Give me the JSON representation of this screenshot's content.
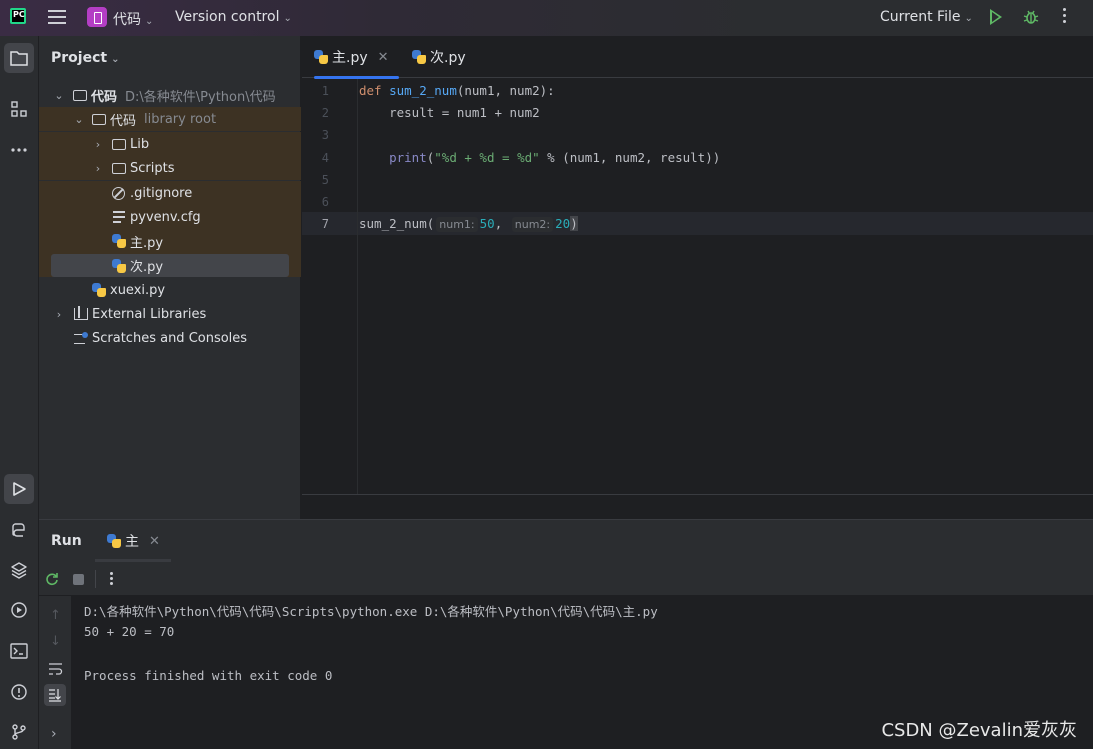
{
  "titlebar": {
    "logo_text": "PC",
    "project_name": "代码",
    "vcs_label": "Version control",
    "run_config": "Current File"
  },
  "project_panel": {
    "title": "Project",
    "tree": [
      {
        "name": "代码",
        "extra": "D:\\各种软件\\Python\\代码"
      },
      {
        "name": "代码",
        "extra": "library root"
      },
      {
        "name": "Lib"
      },
      {
        "name": "Scripts"
      },
      {
        "name": ".gitignore"
      },
      {
        "name": "pyvenv.cfg"
      },
      {
        "name": "主.py"
      },
      {
        "name": "次.py"
      },
      {
        "name": "xuexi.py"
      },
      {
        "name": "External Libraries"
      },
      {
        "name": "Scratches and Consoles"
      }
    ]
  },
  "editor": {
    "tabs": [
      {
        "label": "主.py",
        "active": true
      },
      {
        "label": "次.py",
        "active": false
      }
    ],
    "line_numbers": [
      "1",
      "2",
      "3",
      "4",
      "5",
      "6",
      "7"
    ],
    "code": {
      "l1_kw": "def",
      "l1_fn": "sum_2_num",
      "l1_rest": "(num1, num2):",
      "l2": "    result = num1 + num2",
      "l4_indent": "    ",
      "l4_bi": "print",
      "l4_open": "(",
      "l4_str": "\"%d + %d = %d\"",
      "l4_rest": " % (num1, num2, result))",
      "l7_fn": "sum_2_num(",
      "l7_hint1": "num1:",
      "l7_val1": "50",
      "l7_sep": ", ",
      "l7_hint2": "num2:",
      "l7_val2": "20",
      "l7_close": ")"
    }
  },
  "run_panel": {
    "title": "Run",
    "tab_label": "主",
    "console": [
      "D:\\各种软件\\Python\\代码\\代码\\Scripts\\python.exe D:\\各种软件\\Python\\代码\\代码\\主.py",
      "50 + 20 = 70",
      "",
      "Process finished with exit code 0"
    ]
  },
  "watermark": "CSDN @Zevalin爱灰灰",
  "colors": {
    "accent": "#3574f0",
    "run_green": "#5fb865",
    "keyword": "#cf8e6d",
    "function": "#56a8f5",
    "string": "#6aab73",
    "number": "#2aacb8"
  }
}
